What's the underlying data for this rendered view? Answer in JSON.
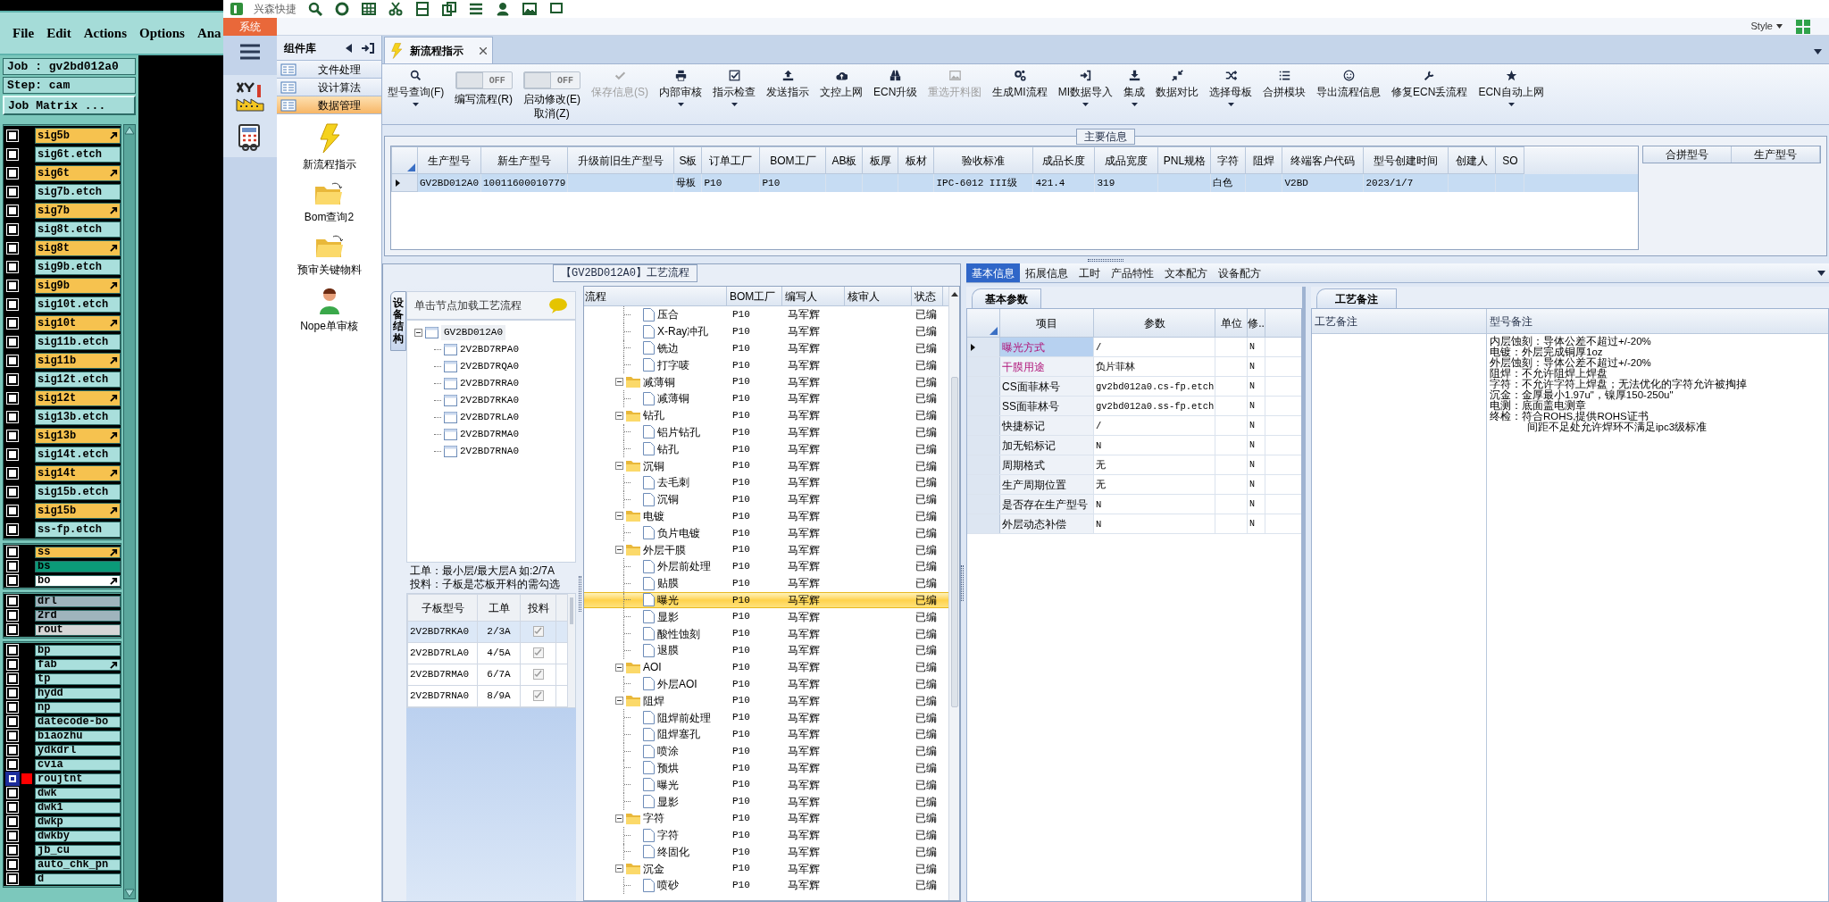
{
  "editor": {
    "menu": [
      "File",
      "Edit",
      "Actions",
      "Options",
      "Ana"
    ],
    "job": "Job : gv2bd012a0",
    "step": "Step: cam",
    "matrix_button": "Job Matrix ...",
    "layer_groups": [
      {
        "layers": [
          {
            "name": "sig5b",
            "color": "#f6c24f",
            "arrow": true,
            "selected": false
          },
          {
            "name": "sig6t.etch",
            "color": "#a9dfdc",
            "arrow": false,
            "selected": false
          },
          {
            "name": "sig6t",
            "color": "#f6c24f",
            "arrow": true,
            "selected": false
          },
          {
            "name": "sig7b.etch",
            "color": "#a9dfdc",
            "arrow": false,
            "selected": false
          },
          {
            "name": "sig7b",
            "color": "#f6c24f",
            "arrow": true,
            "selected": false
          },
          {
            "name": "sig8t.etch",
            "color": "#a9dfdc",
            "arrow": false,
            "selected": false
          },
          {
            "name": "sig8t",
            "color": "#f6c24f",
            "arrow": true,
            "selected": false
          },
          {
            "name": "sig9b.etch",
            "color": "#a9dfdc",
            "arrow": false,
            "selected": false
          },
          {
            "name": "sig9b",
            "color": "#f6c24f",
            "arrow": true,
            "selected": false
          },
          {
            "name": "sig10t.etch",
            "color": "#a9dfdc",
            "arrow": false,
            "selected": false
          },
          {
            "name": "sig10t",
            "color": "#f6c24f",
            "arrow": true,
            "selected": false
          },
          {
            "name": "sig11b.etch",
            "color": "#a9dfdc",
            "arrow": false,
            "selected": false
          },
          {
            "name": "sig11b",
            "color": "#f6c24f",
            "arrow": true,
            "selected": false
          },
          {
            "name": "sig12t.etch",
            "color": "#a9dfdc",
            "arrow": false,
            "selected": false
          },
          {
            "name": "sig12t",
            "color": "#f6c24f",
            "arrow": true,
            "selected": false
          },
          {
            "name": "sig13b.etch",
            "color": "#a9dfdc",
            "arrow": false,
            "selected": false
          },
          {
            "name": "sig13b",
            "color": "#f6c24f",
            "arrow": true,
            "selected": false
          },
          {
            "name": "sig14t.etch",
            "color": "#a9dfdc",
            "arrow": false,
            "selected": false
          },
          {
            "name": "sig14t",
            "color": "#f6c24f",
            "arrow": true,
            "selected": false
          },
          {
            "name": "sig15b.etch",
            "color": "#a9dfdc",
            "arrow": false,
            "selected": false
          },
          {
            "name": "sig15b",
            "color": "#f6c24f",
            "arrow": true,
            "selected": false
          },
          {
            "name": "ss-fp.etch",
            "color": "#a9dfdc",
            "arrow": false,
            "selected": false
          }
        ]
      },
      {
        "layers": [
          {
            "name": "ss",
            "color": "#f6c24f",
            "arrow": true,
            "selected": false
          },
          {
            "name": "bs",
            "color": "#0b9a78",
            "arrow": false,
            "selected": false
          },
          {
            "name": "bo",
            "color": "#ffffff",
            "arrow": true,
            "selected": false
          }
        ]
      },
      {
        "layers": [
          {
            "name": "drl",
            "color": "#9fb4bd",
            "arrow": false,
            "selected": false
          },
          {
            "name": "2rd",
            "color": "#9fb4bd",
            "arrow": false,
            "selected": false
          },
          {
            "name": "rout",
            "color": "#d6d6d6",
            "arrow": false,
            "selected": false
          }
        ]
      },
      {
        "layers": [
          {
            "name": "bp",
            "color": "#a9dfdc",
            "arrow": false,
            "selected": false
          },
          {
            "name": "fab",
            "color": "#a9dfdc",
            "arrow": true,
            "selected": false
          },
          {
            "name": "tp",
            "color": "#a9dfdc",
            "arrow": false,
            "selected": false
          },
          {
            "name": "hydd",
            "color": "#a9dfdc",
            "arrow": false,
            "selected": false
          },
          {
            "name": "np",
            "color": "#a9dfdc",
            "arrow": false,
            "selected": false
          },
          {
            "name": "datecode-bo",
            "color": "#a9dfdc",
            "arrow": false,
            "selected": false
          },
          {
            "name": "biaozhu",
            "color": "#a9dfdc",
            "arrow": false,
            "selected": false
          },
          {
            "name": "ydkdrl",
            "color": "#a9dfdc",
            "arrow": false,
            "selected": false
          },
          {
            "name": "cvia",
            "color": "#a9dfdc",
            "arrow": false,
            "selected": false
          },
          {
            "name": "roujtnt",
            "color": "#a9dfdc",
            "arrow": false,
            "selected": true
          },
          {
            "name": "dwk",
            "color": "#a9dfdc",
            "arrow": false,
            "selected": false
          },
          {
            "name": "dwk1",
            "color": "#a9dfdc",
            "arrow": false,
            "selected": false
          },
          {
            "name": "dwkp",
            "color": "#a9dfdc",
            "arrow": false,
            "selected": false
          },
          {
            "name": "dwkby",
            "color": "#a9dfdc",
            "arrow": false,
            "selected": false
          },
          {
            "name": "jb_cu",
            "color": "#a9dfdc",
            "arrow": false,
            "selected": false
          },
          {
            "name": "auto_chk_pn",
            "color": "#a9dfdc",
            "arrow": false,
            "selected": false
          },
          {
            "name": "d",
            "color": "#a9dfdc",
            "arrow": false,
            "selected": false
          }
        ]
      }
    ]
  },
  "app": {
    "brand": "兴森快捷",
    "system_tab": "系统",
    "style_menu": "Style",
    "library": {
      "title": "组件库",
      "categories": [
        {
          "label": "文件处理",
          "selected": false
        },
        {
          "label": "设计算法",
          "selected": false
        },
        {
          "label": "数据管理",
          "selected": true
        }
      ],
      "items": [
        {
          "label": "新流程指示",
          "kind": "lightning"
        },
        {
          "label": "Bom查询2",
          "kind": "folder"
        },
        {
          "label": "预审关键物料",
          "kind": "folder"
        },
        {
          "label": "Nope单审核",
          "kind": "person"
        }
      ]
    },
    "document_tab": {
      "label": "新流程指示"
    },
    "toolbar": [
      {
        "kind": "button",
        "label": "型号查询(F)",
        "dropdown": true,
        "disabled": false
      },
      {
        "kind": "toggle",
        "label": "编写流程(R)",
        "state_text": "OFF",
        "on": false
      },
      {
        "kind": "toggle",
        "label": "启动修改(E)\n取消(Z)",
        "state_text": "OFF",
        "on": false
      },
      {
        "kind": "button",
        "label": "保存信息(S)",
        "dropdown": false,
        "disabled": true
      },
      {
        "kind": "button",
        "label": "内部审核",
        "dropdown": true,
        "disabled": false
      },
      {
        "kind": "button",
        "label": "指示检查",
        "dropdown": true,
        "disabled": false
      },
      {
        "kind": "button",
        "label": "发送指示",
        "dropdown": false,
        "disabled": false
      },
      {
        "kind": "button",
        "label": "文控上网",
        "dropdown": false,
        "disabled": false
      },
      {
        "kind": "button",
        "label": "ECN升级",
        "dropdown": false,
        "disabled": false
      },
      {
        "kind": "button",
        "label": "重选开料图",
        "dropdown": false,
        "disabled": true
      },
      {
        "kind": "button",
        "label": "生成MI流程",
        "dropdown": false,
        "disabled": false
      },
      {
        "kind": "button",
        "label": "MI数据导入",
        "dropdown": true,
        "disabled": false
      },
      {
        "kind": "button",
        "label": "集成",
        "dropdown": true,
        "disabled": false
      },
      {
        "kind": "button",
        "label": "数据对比",
        "dropdown": false,
        "disabled": false
      },
      {
        "kind": "button",
        "label": "选择母板",
        "dropdown": true,
        "disabled": false
      },
      {
        "kind": "button",
        "label": "合拼模块",
        "dropdown": false,
        "disabled": false
      },
      {
        "kind": "button",
        "label": "导出流程信息",
        "dropdown": false,
        "disabled": false
      },
      {
        "kind": "button",
        "label": "修复ECN丢流程",
        "dropdown": false,
        "disabled": false
      },
      {
        "kind": "button",
        "label": "ECN自动上网",
        "dropdown": true,
        "disabled": false
      }
    ],
    "main_info": {
      "title": "主要信息",
      "columns": [
        "生产型号",
        "新生产型号",
        "升级前旧生产型号",
        "S板",
        "订单工厂",
        "BOM工厂",
        "AB板",
        "板厚",
        "板材",
        "验收标准",
        "成品长度",
        "成品宽度",
        "PNL规格",
        "字符",
        "阻焊",
        "终端客户代码",
        "型号创建时间",
        "创建人",
        "SO"
      ],
      "rows": [
        {
          "selected": true,
          "cells": [
            "GV2BD012A0",
            "10011600010779",
            null,
            "母板",
            "P10",
            "P10",
            null,
            null,
            null,
            "IPC-6012 III级",
            "421.4",
            "319",
            null,
            "白色",
            null,
            "V2BD",
            "2023/1/7",
            null,
            null
          ]
        }
      ],
      "merge_columns": [
        "合拼型号",
        "生产型号"
      ]
    },
    "process": {
      "title": "【GV2BD012A0】工艺流程",
      "side_tab": "设备结构",
      "tree_header": "单击节点加载工艺流程",
      "tree": [
        {
          "label": "GV2BD012A0",
          "expanded": true,
          "children": [
            {
              "label": "2V2BD7RPA0"
            },
            {
              "label": "2V2BD7RQA0"
            },
            {
              "label": "2V2BD7RRA0"
            },
            {
              "label": "2V2BD7RKA0"
            },
            {
              "label": "2V2BD7RLA0"
            },
            {
              "label": "2V2BD7RMA0"
            },
            {
              "label": "2V2BD7RNA0"
            }
          ]
        }
      ],
      "note": "工单：最小层/最大层A 如:2/7A\n投料：子板是芯板开料的需勾选",
      "sub_boards": {
        "columns": [
          "子板型号",
          "工单",
          "投料"
        ],
        "rows": [
          {
            "board": "2V2BD7RKA0",
            "order": "2/3A",
            "checked": true,
            "selected": true
          },
          {
            "board": "2V2BD7RLA0",
            "order": "4/5A",
            "checked": true,
            "selected": false
          },
          {
            "board": "2V2BD7RMA0",
            "order": "6/7A",
            "checked": true,
            "selected": false
          },
          {
            "board": "2V2BD7RNA0",
            "order": "8/9A",
            "checked": true,
            "selected": false
          }
        ]
      },
      "flow": {
        "columns": [
          "流程",
          "BOM工厂",
          "编写人",
          "核审人",
          "状态"
        ],
        "groups": [
          {
            "children": [
              {
                "label": "压合",
                "factory": "P10",
                "author": "马军辉",
                "status": "已编",
                "selected": false
              },
              {
                "label": "X-Ray冲孔",
                "factory": "P10",
                "author": "马军辉",
                "status": "已编",
                "selected": false
              },
              {
                "label": "铣边",
                "factory": "P10",
                "author": "马军辉",
                "status": "已编",
                "selected": false
              },
              {
                "label": "打字唛",
                "factory": "P10",
                "author": "马军辉",
                "status": "已编",
                "selected": false
              }
            ]
          },
          {
            "label": "减薄铜",
            "factory": "P10",
            "author": "马军辉",
            "status": "已编",
            "selected": false,
            "expanded": true,
            "children": [
              {
                "label": "减薄铜",
                "factory": "P10",
                "author": "马军辉",
                "status": "已编",
                "selected": false
              }
            ]
          },
          {
            "label": "钻孔",
            "factory": "P10",
            "author": "马军辉",
            "status": "已编",
            "selected": false,
            "expanded": true,
            "children": [
              {
                "label": "铝片钻孔",
                "factory": "P10",
                "author": "马军辉",
                "status": "已编",
                "selected": false
              },
              {
                "label": "钻孔",
                "factory": "P10",
                "author": "马军辉",
                "status": "已编",
                "selected": false
              }
            ]
          },
          {
            "label": "沉铜",
            "factory": "P10",
            "author": "马军辉",
            "status": "已编",
            "selected": false,
            "expanded": true,
            "children": [
              {
                "label": "去毛刺",
                "factory": "P10",
                "author": "马军辉",
                "status": "已编",
                "selected": false
              },
              {
                "label": "沉铜",
                "factory": "P10",
                "author": "马军辉",
                "status": "已编",
                "selected": false
              }
            ]
          },
          {
            "label": "电镀",
            "factory": "P10",
            "author": "马军辉",
            "status": "已编",
            "selected": false,
            "expanded": true,
            "children": [
              {
                "label": "负片电镀",
                "factory": "P10",
                "author": "马军辉",
                "status": "已编",
                "selected": false
              }
            ]
          },
          {
            "label": "外层干膜",
            "factory": "P10",
            "author": "马军辉",
            "status": "已编",
            "selected": false,
            "expanded": true,
            "children": [
              {
                "label": "外层前处理",
                "factory": "P10",
                "author": "马军辉",
                "status": "已编",
                "selected": false
              },
              {
                "label": "贴膜",
                "factory": "P10",
                "author": "马军辉",
                "status": "已编",
                "selected": false
              },
              {
                "label": "曝光",
                "factory": "P10",
                "author": "马军辉",
                "status": "已编",
                "selected": true
              },
              {
                "label": "显影",
                "factory": "P10",
                "author": "马军辉",
                "status": "已编",
                "selected": false
              },
              {
                "label": "酸性蚀刻",
                "factory": "P10",
                "author": "马军辉",
                "status": "已编",
                "selected": false
              },
              {
                "label": "退膜",
                "factory": "P10",
                "author": "马军辉",
                "status": "已编",
                "selected": false
              }
            ]
          },
          {
            "label": "AOI",
            "factory": "P10",
            "author": "马军辉",
            "status": "已编",
            "selected": false,
            "expanded": true,
            "children": [
              {
                "label": "外层AOI",
                "factory": "P10",
                "author": "马军辉",
                "status": "已编",
                "selected": false
              }
            ]
          },
          {
            "label": "阻焊",
            "factory": "P10",
            "author": "马军辉",
            "status": "已编",
            "selected": false,
            "expanded": true,
            "children": [
              {
                "label": "阻焊前处理",
                "factory": "P10",
                "author": "马军辉",
                "status": "已编",
                "selected": false
              },
              {
                "label": "阻焊塞孔",
                "factory": "P10",
                "author": "马军辉",
                "status": "已编",
                "selected": false
              },
              {
                "label": "喷涂",
                "factory": "P10",
                "author": "马军辉",
                "status": "已编",
                "selected": false
              },
              {
                "label": "预烘",
                "factory": "P10",
                "author": "马军辉",
                "status": "已编",
                "selected": false
              },
              {
                "label": "曝光",
                "factory": "P10",
                "author": "马军辉",
                "status": "已编",
                "selected": false
              },
              {
                "label": "显影",
                "factory": "P10",
                "author": "马军辉",
                "status": "已编",
                "selected": false
              }
            ]
          },
          {
            "label": "字符",
            "factory": "P10",
            "author": "马军辉",
            "status": "已编",
            "selected": false,
            "expanded": true,
            "children": [
              {
                "label": "字符",
                "factory": "P10",
                "author": "马军辉",
                "status": "已编",
                "selected": false
              },
              {
                "label": "终固化",
                "factory": "P10",
                "author": "马军辉",
                "status": "已编",
                "selected": false
              }
            ]
          },
          {
            "label": "沉金",
            "factory": "P10",
            "author": "马军辉",
            "status": "已编",
            "selected": false,
            "expanded": true,
            "children": [
              {
                "label": "喷砂",
                "factory": "P10",
                "author": "马军辉",
                "status": "已编",
                "selected": false
              }
            ]
          }
        ]
      }
    },
    "detail": {
      "tabs": [
        {
          "label": "基本信息",
          "selected": true
        },
        {
          "label": "拓展信息",
          "selected": false
        },
        {
          "label": "工时",
          "selected": false
        },
        {
          "label": "产品特性",
          "selected": false
        },
        {
          "label": "文本配方",
          "selected": false
        },
        {
          "label": "设备配方",
          "selected": false
        }
      ],
      "params": {
        "tab": "基本参数",
        "columns": [
          "项目",
          "参数",
          "单位",
          "修.."
        ],
        "rows": [
          {
            "item": "曝光方式",
            "value": "/",
            "flag": "N",
            "highlight": true,
            "selected": true
          },
          {
            "item": "干膜用途",
            "value": "负片菲林",
            "flag": "N",
            "highlight": true,
            "selected": false
          },
          {
            "item": "CS面菲林号",
            "value": "gv2bd012a0.cs-fp.etch",
            "flag": "N",
            "highlight": false,
            "selected": false
          },
          {
            "item": "SS面菲林号",
            "value": "gv2bd012a0.ss-fp.etch",
            "flag": "N",
            "highlight": false,
            "selected": false
          },
          {
            "item": "快捷标记",
            "value": "/",
            "flag": "N",
            "highlight": false,
            "selected": false
          },
          {
            "item": "加无铅标记",
            "value": "N",
            "flag": "N",
            "highlight": false,
            "selected": false
          },
          {
            "item": "周期格式",
            "value": "无",
            "flag": "N",
            "highlight": false,
            "selected": false
          },
          {
            "item": "生产周期位置",
            "value": "无",
            "flag": "N",
            "highlight": false,
            "selected": false
          },
          {
            "item": "是否存在生产型号",
            "value": "N",
            "flag": "N",
            "highlight": false,
            "selected": false
          },
          {
            "item": "外层动态补偿",
            "value": "N",
            "flag": "N",
            "highlight": false,
            "selected": false
          }
        ]
      },
      "remarks": {
        "tab": "工艺备注",
        "columns": [
          "工艺备注",
          "型号备注"
        ],
        "lines": [
          "内层蚀刻：导体公差不超过+/-20%",
          "电镀：外层完成铜厚1oz",
          "外层蚀刻：导体公差不超过+/-20%",
          "阻焊：不允许阻焊上焊盘",
          "字符：不允许字符上焊盘；无法优化的字符允许被掏掉",
          "沉金：金厚最小1.97u\"，镍厚150-250u\"",
          "电测：底面盖电测章",
          "终检：符合ROHS,提供ROHS证书",
          "间距不足处允许焊环不满足ipc3级标准"
        ]
      }
    }
  }
}
